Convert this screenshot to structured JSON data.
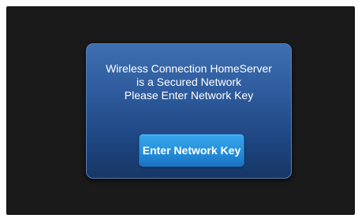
{
  "dialog": {
    "message_lines": [
      "Wireless Connection HomeServer",
      "is a Secured Network",
      "Please Enter Network Key"
    ],
    "button_label": "Enter Network Key"
  },
  "colors": {
    "screen_background": "#1a1a1a",
    "dialog_background": "#2e5c9e",
    "button_background": "#2791dd",
    "text": "#ffffff"
  }
}
